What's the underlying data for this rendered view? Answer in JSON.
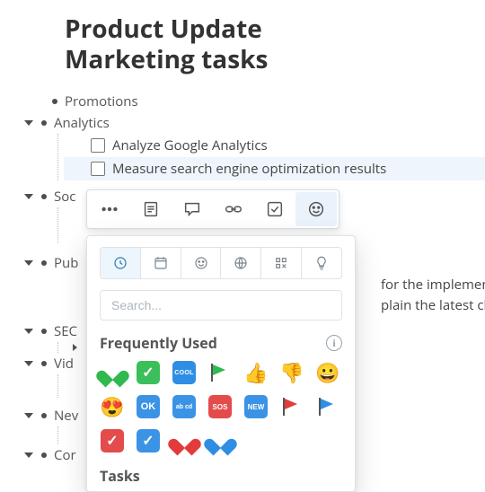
{
  "title": "Product Update Marketing tasks",
  "tree": {
    "promotions": "Promotions",
    "analytics": "Analytics",
    "analytics_items": [
      "Analyze Google Analytics",
      "Measure search engine optimization results"
    ],
    "social": "Soc",
    "publish": "Pub",
    "publish_para": "for the implemented",
    "publish_para2": "plain the latest chang",
    "seo": "SEC",
    "video": "Vid",
    "newsletter": "Nev",
    "content": "Cor"
  },
  "toolbar": {
    "more": "more",
    "page": "page",
    "comment": "comment",
    "link": "link",
    "task": "task",
    "emoji": "emoji"
  },
  "picker": {
    "search_placeholder": "Search...",
    "section_frequent": "Frequently Used",
    "section_tasks": "Tasks",
    "info": "i",
    "badges": {
      "cool": "COOL",
      "ok": "OK",
      "abcd": "ab\ncd",
      "sos": "SOS",
      "new": "NEW"
    },
    "emojis_row1": [
      "",
      "",
      "",
      "",
      "👍",
      "👎",
      "😀"
    ],
    "emojis_row2": [
      "😍",
      "",
      "",
      "",
      "",
      "",
      ""
    ],
    "emojis_row3": [
      "",
      "",
      "",
      ""
    ]
  }
}
